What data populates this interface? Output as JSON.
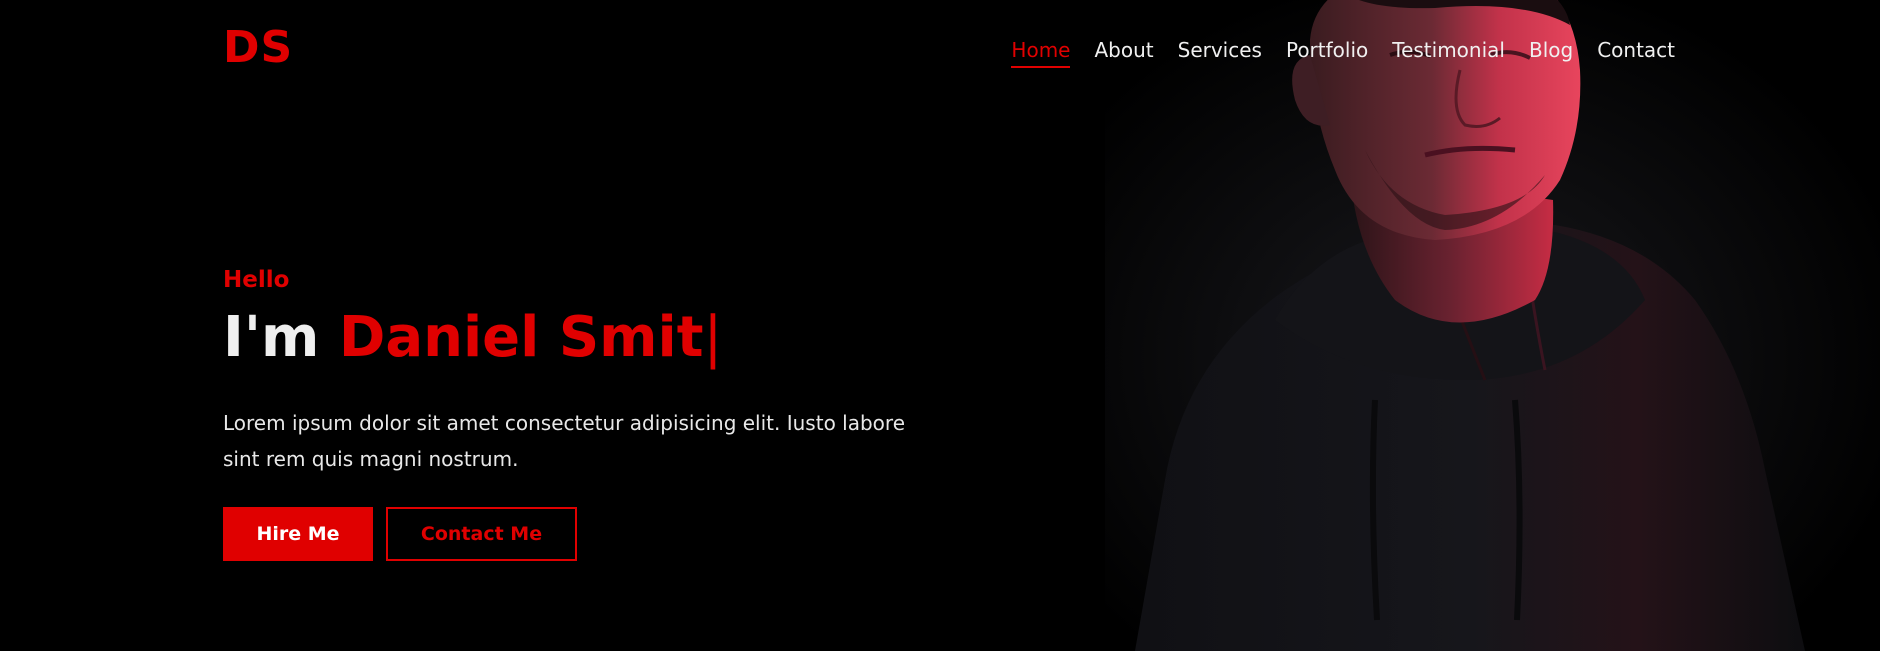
{
  "header": {
    "logo": "DS",
    "nav": [
      {
        "label": "Home",
        "active": true
      },
      {
        "label": "About"
      },
      {
        "label": "Services"
      },
      {
        "label": "Portfolio"
      },
      {
        "label": "Testimonial"
      },
      {
        "label": "Blog"
      },
      {
        "label": "Contact"
      }
    ]
  },
  "hero": {
    "greeting": "Hello",
    "title_prefix": "I'm",
    "name": "Daniel Smit",
    "cursor": "|",
    "description": "Lorem ipsum dolor sit amet consectetur adipisicing elit. Iusto labore sint rem quis magni nostrum.",
    "hire_button": "Hire Me",
    "contact_button": "Contact Me"
  },
  "theme": {
    "accent": "#e00000",
    "background": "#000000",
    "text": "#efefef"
  }
}
